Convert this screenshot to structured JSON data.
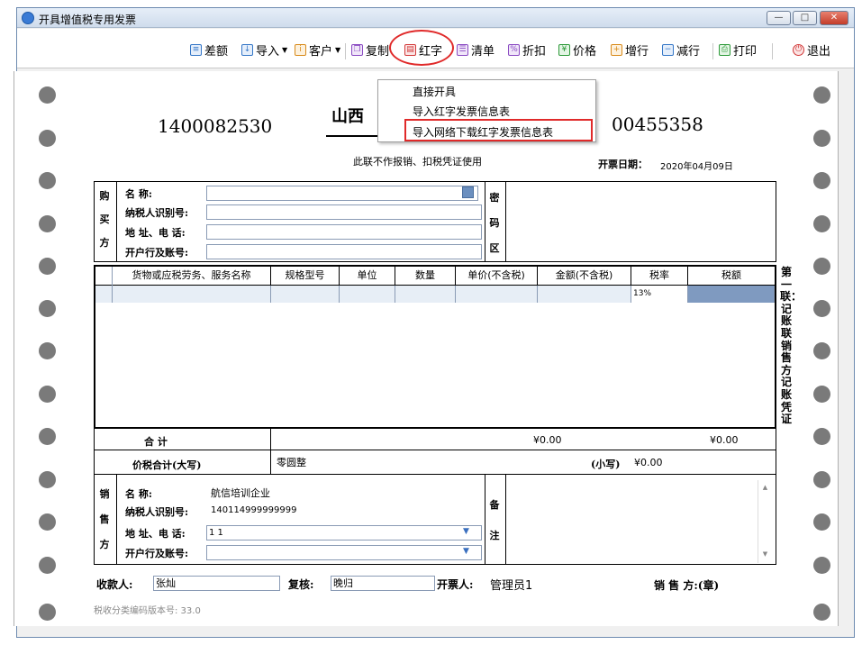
{
  "window": {
    "title": "开具增值税专用发票"
  },
  "toolbar": {
    "items": [
      {
        "label": "差额"
      },
      {
        "label": "导入"
      },
      {
        "label": "客户"
      },
      {
        "label": "复制"
      },
      {
        "label": "红字"
      },
      {
        "label": "清单"
      },
      {
        "label": "折扣"
      },
      {
        "label": "价格"
      },
      {
        "label": "增行"
      },
      {
        "label": "减行"
      },
      {
        "label": "打印"
      },
      {
        "label": "退出"
      }
    ]
  },
  "dropdown": {
    "items": [
      {
        "label": "直接开具"
      },
      {
        "label": "导入红字发票信息表"
      },
      {
        "label": "导入网络下载红字发票信息表"
      }
    ]
  },
  "invoice": {
    "code_left": "1400082530",
    "title": "山西",
    "number": "00455358",
    "notice": "此联不作报销、扣税凭证使用",
    "date_label": "开票日期：",
    "date": "2020年04月09日",
    "buyer": {
      "section": [
        "购",
        "买",
        "方"
      ],
      "name_label": "名          称:",
      "tax_id_label": "纳税人识别号:",
      "address_label": "地 址、电 话:",
      "bank_label": "开户行及账号:",
      "name_value": "",
      "tax_id_value": "",
      "address_value": "",
      "bank_value": ""
    },
    "cipher": [
      "密",
      "码",
      "区"
    ],
    "columns": [
      "货物或应税劳务、服务名称",
      "规格型号",
      "单位",
      "数量",
      "单价(不含税)",
      "金额(不含税)",
      "税率",
      "税额"
    ],
    "row": {
      "tax_rate": "13%"
    },
    "total_label": "合          计",
    "total_amount": "¥0.00",
    "total_tax": "¥0.00",
    "grand_label": "价税合计(大写)",
    "grand_upper": "零圆整",
    "grand_small_label": "(小写)",
    "grand_small": "¥0.00",
    "seller": {
      "section": [
        "销",
        "售",
        "方"
      ],
      "name_label": "名          称:",
      "name_value": "航信培训企业",
      "tax_id_label": "纳税人识别号:",
      "tax_id_value": "140114999999999",
      "address_label": "地 址、电 话:",
      "address_value": "1 1",
      "bank_label": "开户行及账号:",
      "bank_value": ""
    },
    "remark": [
      "备",
      "注"
    ],
    "payee_label": "收款人:",
    "payee": "张灿",
    "reviewer_label": "复核:",
    "reviewer": "晚归",
    "drawer_label": "开票人:",
    "drawer": "管理员1",
    "seller_stamp": "销 售 方:(章)",
    "version": "税收分类编码版本号: 33.0",
    "side_note": "第一联：记账联 销售方记账凭证"
  }
}
